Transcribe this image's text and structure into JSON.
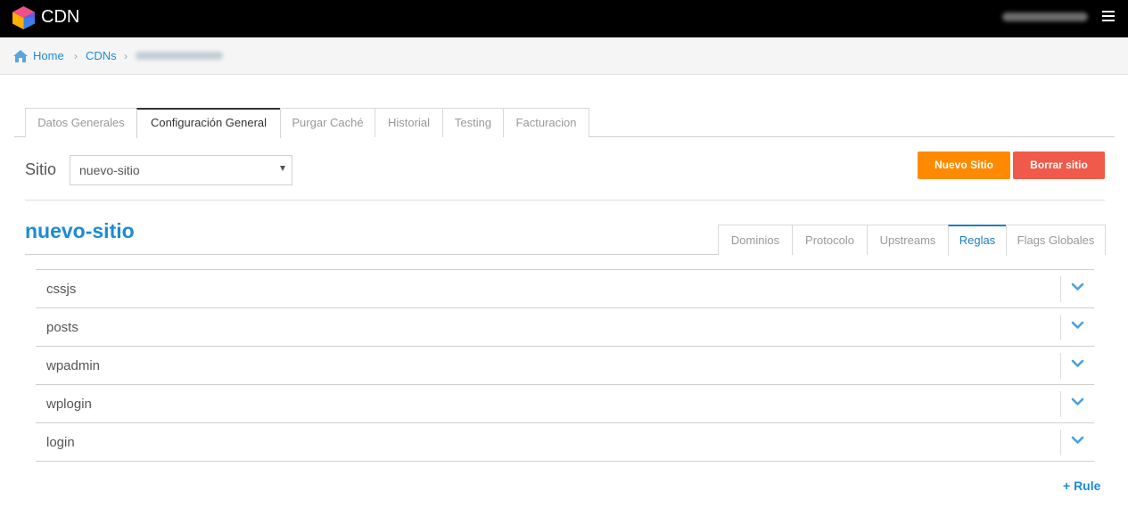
{
  "app": {
    "title": "CDN"
  },
  "header": {
    "user_email": "",
    "menu_icon": "hamburger-icon"
  },
  "breadcrumb": {
    "home": "Home",
    "cdns": "CDNs",
    "current": ""
  },
  "tabs": [
    {
      "label": "Datos Generales"
    },
    {
      "label": "Configuración General"
    },
    {
      "label": "Purgar Caché"
    },
    {
      "label": "Historial"
    },
    {
      "label": "Testing"
    },
    {
      "label": "Facturacion"
    }
  ],
  "sitio": {
    "label": "Sitio",
    "value": "nuevo-sitio"
  },
  "actions": {
    "new_site": "Nuevo Sitio",
    "delete_site": "Borrar sitio"
  },
  "site": {
    "title": "nuevo-sitio"
  },
  "subtabs": [
    {
      "label": "Dominios"
    },
    {
      "label": "Protocolo"
    },
    {
      "label": "Upstreams"
    },
    {
      "label": "Reglas"
    },
    {
      "label": "Flags Globales"
    }
  ],
  "rules": [
    {
      "name": "cssjs"
    },
    {
      "name": "posts"
    },
    {
      "name": "wpadmin"
    },
    {
      "name": "wplogin"
    },
    {
      "name": "login"
    }
  ],
  "add_rule": "+ Rule",
  "colors": {
    "accent": "#1b8bd6",
    "orange": "#ff8a00",
    "red": "#ef5a4a",
    "topbar": "#000000"
  }
}
